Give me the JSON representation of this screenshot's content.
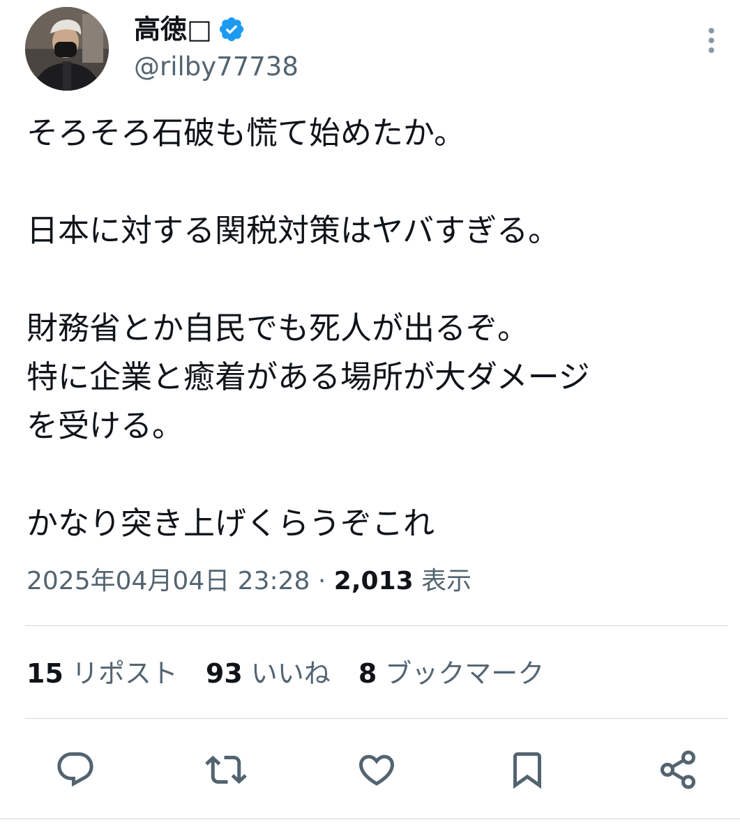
{
  "author": {
    "display_name": "高徳□",
    "handle": "@rilby77738",
    "verified": true,
    "avatar_icon": "profile-photo-masked-man"
  },
  "tweet": {
    "lines": [
      "そろそろ石破も慌て始めたか。",
      "",
      "日本に対する関税対策はヤバすぎる。",
      "",
      "財務省とか自民でも死人が出るぞ。",
      "特に企業と癒着がある場所が大ダメージ",
      "を受ける。",
      "",
      "かなり突き上げくらうぞこれ"
    ],
    "timestamp": "2025年04月04日 23:28",
    "separator": "·",
    "views_count": "2,013",
    "views_label": "表示"
  },
  "stats": {
    "reposts_count": "15",
    "reposts_label": "リポスト",
    "likes_count": "93",
    "likes_label": "いいね",
    "bookmarks_count": "8",
    "bookmarks_label": "ブックマーク"
  },
  "actions": [
    "reply-icon",
    "repost-icon",
    "like-icon",
    "bookmark-icon",
    "share-icon"
  ],
  "colors": {
    "text": "#0f1419",
    "secondary": "#536471",
    "verified": "#1d9bf0",
    "divider": "#cfd9de"
  }
}
